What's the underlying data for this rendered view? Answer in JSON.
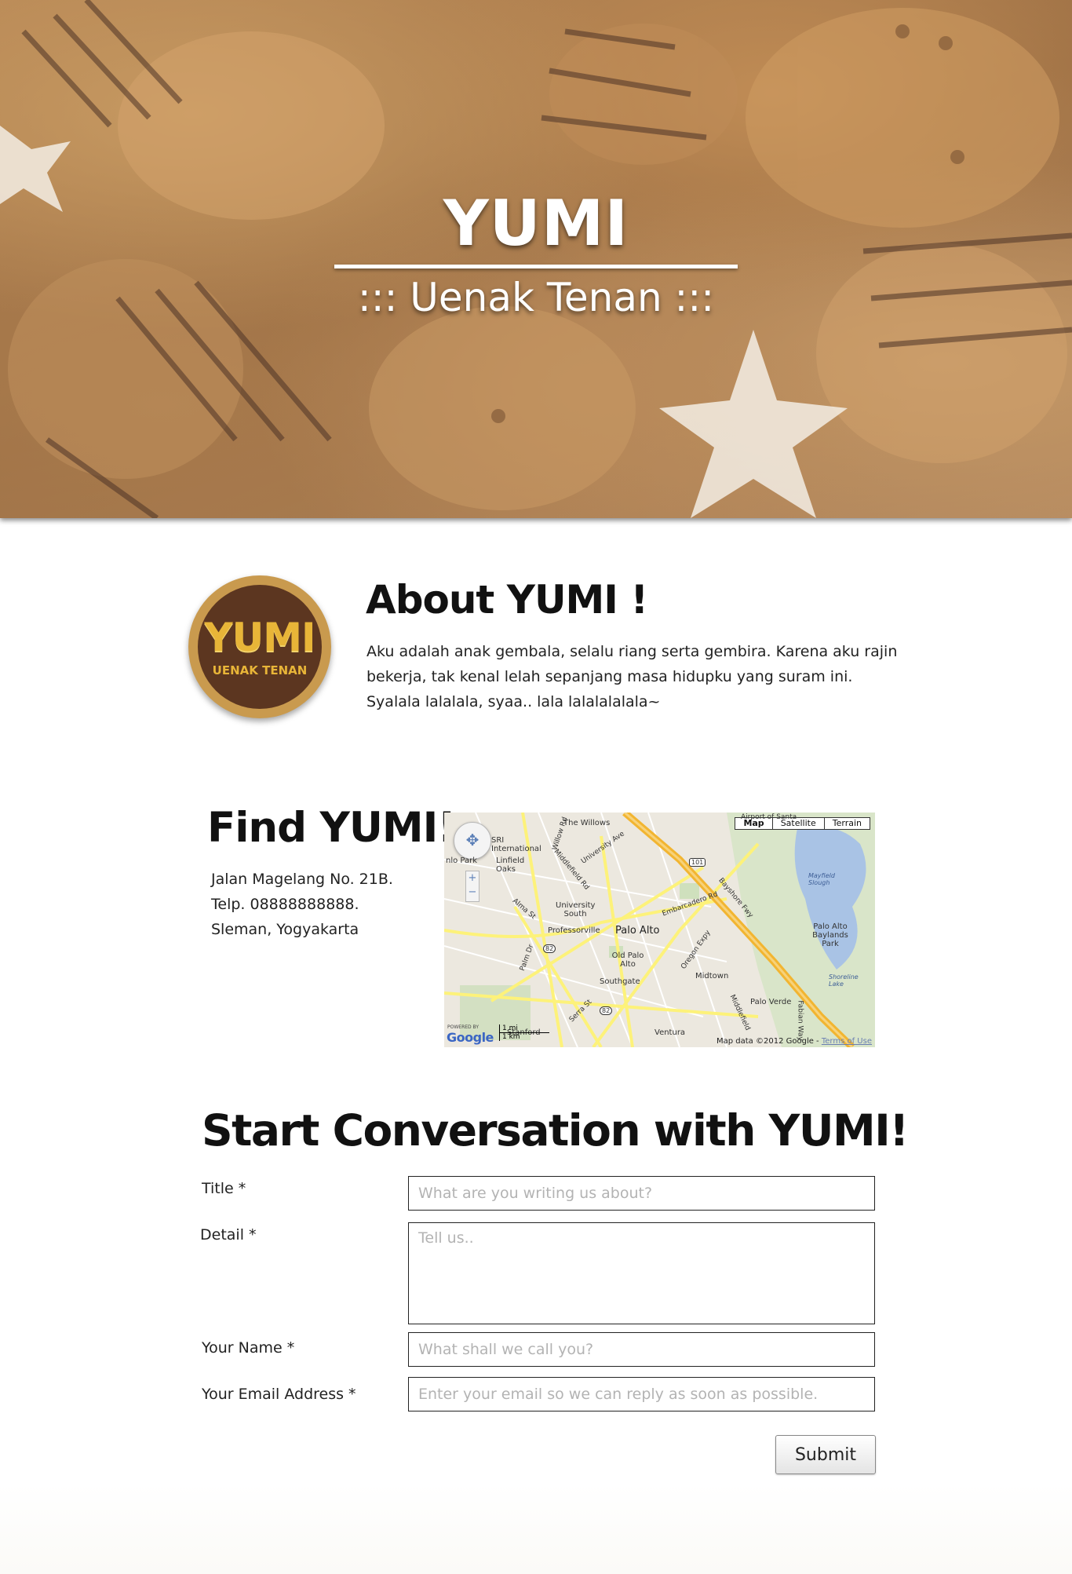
{
  "hero": {
    "title": "YUMI",
    "subtitle": "::: Uenak Tenan :::"
  },
  "about": {
    "logo_word": "YUMI",
    "logo_tagline": "UENAK TENAN",
    "title": "About YUMI !",
    "text": "Aku adalah anak gembala, selalu riang serta gembira. Karena aku rajin bekerja, tak kenal lelah sepanjang masa hidupku yang suram ini. Syalala lalalala, syaa.. lala lalalalalala~"
  },
  "find": {
    "title": "Find YUMI!",
    "address_lines": [
      "Jalan Magelang No. 21B.",
      "Telp. 08888888888.",
      "Sleman, Yogyakarta"
    ],
    "map": {
      "types": [
        "Map",
        "Satellite",
        "Terrain"
      ],
      "active_type": "Map",
      "labels": [
        "The Willows",
        "SRI International",
        "Linfield Oaks",
        "University South",
        "Professorville",
        "Palo Alto",
        "Old Palo Alto",
        "Southgate",
        "Midtown",
        "Palo Verde",
        "Ventura",
        "Palo Alto Baylands Park",
        "Mayfield Slough",
        "Shoreline Lake",
        "Willow Rd",
        "Middlefield Rd",
        "Embarcadero Rd",
        "Bayshore Fwy",
        "Oregon Expy",
        "Alma St",
        "Palm Dr",
        "Serra St",
        "University Ave",
        "Stanford",
        "Airport of Santa",
        "nlo Park",
        "Fabian Way",
        "Middlefield"
      ],
      "route_shields": [
        "101",
        "82",
        "82"
      ],
      "scale": [
        "1 mi",
        "1 km"
      ],
      "powered_by": "POWERED BY",
      "logo": "Google",
      "credit": "Map data ©2012 Google -",
      "terms": "Terms of Use"
    }
  },
  "form": {
    "title": "Start Conversation with YUMI!",
    "fields": [
      {
        "label": "Title *",
        "placeholder": "What are you writing us about?"
      },
      {
        "label": "Detail *",
        "placeholder": "Tell us.."
      },
      {
        "label": "Your Name *",
        "placeholder": "What shall we call you?"
      },
      {
        "label": "Your Email Address *",
        "placeholder": "Enter your email so we can reply as soon as possible."
      }
    ],
    "submit_label": "Submit"
  },
  "colors": {
    "logo_ring": "#c99a4e",
    "logo_fill": "#5c3620",
    "logo_text": "#e8b538",
    "map_road_major": "#f2b531",
    "map_road_minor": "#fdf27a"
  }
}
